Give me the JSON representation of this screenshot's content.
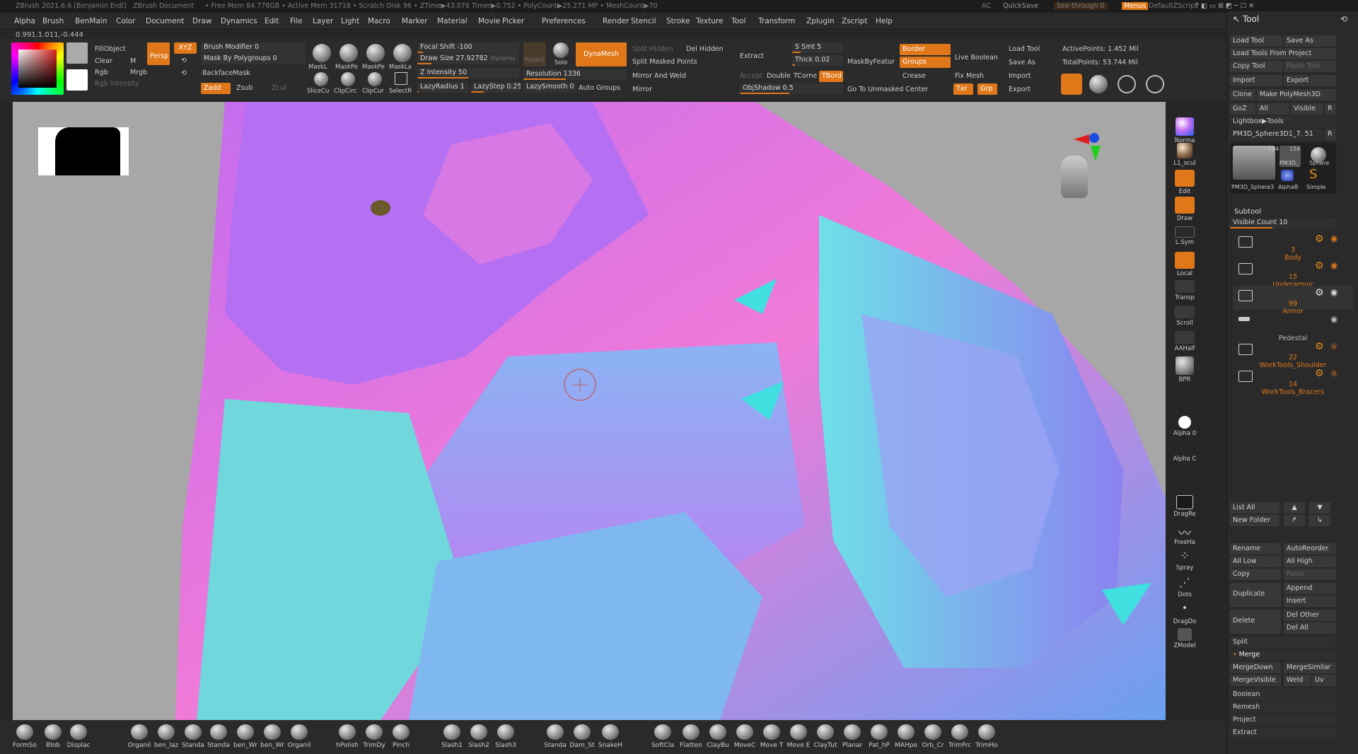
{
  "titlebar": {
    "app": "ZBrush 2021.6.6 [Benjamin Erdt]",
    "doc": "ZBrush Document",
    "stats": "• Free Mem 84.778GB • Active Mem 31718 • Scratch Disk 96 • ZTime▶43.076 Timer▶0.752 • PolyCount▶25.271 MP • MeshCount▶70",
    "ac": "AC",
    "quicksave": "QuickSave",
    "seethrough": "See-through  0",
    "menus": "Menus",
    "defaultscript": "DefaultZScript"
  },
  "menu": [
    "Alpha",
    "Brush",
    "BenMain",
    "Color",
    "Document",
    "Draw",
    "Dynamics",
    "Edit",
    "File",
    "Layer",
    "Light",
    "Macro",
    "Marker",
    "Material",
    "Movie",
    "Picker",
    "Preferences",
    "Render",
    "Stencil",
    "Stroke",
    "Texture",
    "Tool",
    "Transform",
    "Zplugin",
    "Zscript",
    "Help"
  ],
  "coords": "0.991,1.011,-0.444",
  "toolbar": {
    "fillobject": "FillObject",
    "clear": "Clear",
    "m": "M",
    "rgb": "Rgb",
    "mrgb": "Mrgb",
    "rgb_intensity": "Rgb Intensity",
    "persp": "Persp",
    "xyz": "XYZ",
    "brush_modifier": "Brush Modifier 0",
    "mask_by_polygroups": "Mask By Polygroups 0",
    "backfacemask": "BackfaceMask",
    "zadd": "Zadd",
    "zsub": "Zsub",
    "zcut": "Zcut",
    "mask1": "MaskL",
    "mask2": "MaskPe",
    "mask3": "MaskPe",
    "mask4": "MaskLa",
    "slice": "SliceCu",
    "clip1": "ClipCirc",
    "clip2": "ClipCur",
    "select": "SelectR",
    "focal_shift": "Focal Shift -100",
    "draw_size": "Draw Size 27.92782",
    "dynamic": "Dynamic",
    "z_intensity": "Z Intensity 50",
    "lazyradius": "LazyRadius 1",
    "lazystep": "LazyStep 0.25",
    "lazysmooth": "LazySmooth 0",
    "resolution": "Resolution 1336",
    "auto_groups": "Auto Groups",
    "dynamesh": "DynaMesh",
    "project": "Project",
    "solo": "Solo",
    "dynamic2": "Dynamic",
    "split_hidden": "Split Hidden",
    "del_hidden": "Del Hidden",
    "split_masked": "Split Masked Points",
    "mirror_weld": "Mirror And Weld",
    "mirror": "Mirror",
    "extract": "Extract",
    "accept": "Accept",
    "double": "Double",
    "tcorner": "TCorne",
    "tborder": "TBord",
    "ssmt": "S Smt 5",
    "thick": "Thick 0.02",
    "objshadow": "ObjShadow 0.5",
    "maskbyfeature": "MaskByFeatur",
    "border": "Border",
    "groups": "Groups",
    "crease": "Crease",
    "go_unmasked": "Go To Unmasked Center",
    "live_boolean": "Live Boolean",
    "fix_mesh": "Fix Mesh",
    "txr": "Txr",
    "grp": "Grp",
    "load_tool": "Load Tool",
    "save_as": "Save As",
    "import": "Import",
    "export": "Export",
    "active_points": "ActivePoints: 1.452 Mil",
    "total_points": "TotalPoints: 53.744 Mil"
  },
  "shelf": [
    {
      "label": "Norma",
      "icon": "material-sphere-icon"
    },
    {
      "label": "L1_scul",
      "icon": "matcap-sphere-icon"
    },
    {
      "label": "Edit",
      "icon": "edit-icon"
    },
    {
      "label": "Draw",
      "icon": "draw-icon"
    },
    {
      "label": "L.Sym",
      "icon": "local-symmetry-icon"
    },
    {
      "label": "Local",
      "icon": "local-icon"
    },
    {
      "label": "Transp",
      "icon": "transparency-icon"
    },
    {
      "label": "Scroll",
      "icon": "scroll-icon"
    },
    {
      "label": "AAHalf",
      "icon": "aahalf-icon"
    },
    {
      "label": "BPR",
      "icon": "bpr-icon"
    },
    {
      "label": "Alpha 0",
      "icon": "alpha-icon"
    },
    {
      "label": "Alpha C",
      "icon": "alpha-c-icon"
    },
    {
      "label": "DragRe",
      "icon": "dragrect-icon"
    },
    {
      "label": "FreeHa",
      "icon": "freehand-icon"
    },
    {
      "label": "Spray",
      "icon": "spray-icon"
    },
    {
      "label": "Dots",
      "icon": "dots-icon"
    },
    {
      "label": "DragDo",
      "icon": "dragdot-icon"
    },
    {
      "label": "ZModel",
      "icon": "zmodeler-icon"
    }
  ],
  "toolpanel": {
    "title": "Tool",
    "load_tool": "Load Tool",
    "save_as": "Save As",
    "load_from_project": "Load Tools From Project",
    "copy_tool": "Copy Tool",
    "paste_tool": "Paste Tool",
    "import": "Import",
    "export": "Export",
    "clone": "Clone",
    "make_polymesh": "Make PolyMesh3D",
    "goz": "GoZ",
    "all": "All",
    "visible": "Visible",
    "r": "R",
    "lightbox": "Lightbox▶Tools",
    "current_tool": "PM3D_Sphere3D1_7. 51",
    "thumb_count1": "194",
    "thumb_count2": "154",
    "thumb_labels": [
      "PM3D_Sphere3",
      "PM3D_",
      "Sphere",
      "AlphaB",
      "Simple"
    ],
    "subtool_title": "Subtool",
    "visible_count": "Visible Count 10",
    "subtools": [
      {
        "num": "3",
        "name": "Body"
      },
      {
        "num": "15",
        "name": "Underarmor"
      },
      {
        "num": "99",
        "name": "Armor"
      },
      {
        "num": "",
        "name": "Pedestal"
      },
      {
        "num": "22",
        "name": "WorkTools_Shoulder"
      },
      {
        "num": "14",
        "name": "WorkTools_Bracers"
      }
    ],
    "list_all": "List All",
    "new_folder": "New Folder",
    "rename": "Rename",
    "autoreorder": "AutoReorder",
    "all_low": "All Low",
    "all_high": "All High",
    "copy": "Copy",
    "paste": "Paste",
    "duplicate": "Duplicate",
    "append": "Append",
    "insert": "Insert",
    "delete": "Delete",
    "del_other": "Del Other",
    "del_all": "Del All",
    "split": "Split",
    "merge": "Merge",
    "mergedown": "MergeDown",
    "mergesimilar": "MergeSimilar",
    "mergevisible": "MergeVisible",
    "weld": "Weld",
    "uv": "Uv",
    "boolean": "Boolean",
    "remesh": "Remesh",
    "project": "Project",
    "extract": "Extract"
  },
  "brushes": [
    "FormSo",
    "Blob",
    "Displac",
    "OrganiI",
    "ben_laz",
    "Standa",
    "Standa",
    "ben_Wr",
    "ben_Wr",
    "OrganiI",
    "hPolish",
    "TrimDy",
    "Pinch",
    "Slash1",
    "Slash2",
    "Slash3",
    "Standa",
    "Dam_St",
    "SnakeH",
    "SoftCla",
    "Flatten",
    "ClayBu",
    "MoveC",
    "Move T",
    "Move E",
    "ClayTut",
    "Planar",
    "Pat_hP",
    "MAHpo",
    "Orb_Cr",
    "TrimFrc",
    "TrimHo"
  ],
  "colors": {
    "accent": "#e0781a",
    "panel": "#2a2a2a",
    "viewport": "#a7a7a7"
  }
}
